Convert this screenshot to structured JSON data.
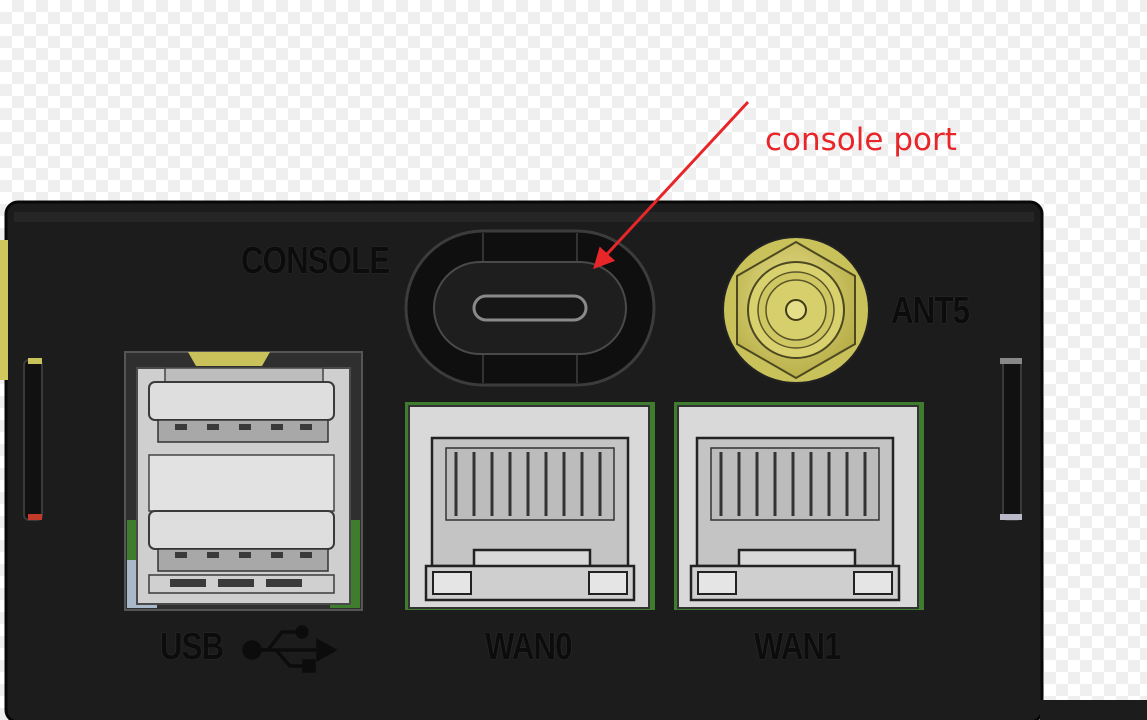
{
  "annotation": {
    "text": "console port",
    "color": "#e8262a"
  },
  "labels": {
    "console": "CONSOLE",
    "antenna": "ANT5",
    "usb": "USB",
    "wan0": "WAN0",
    "wan1": "WAN1"
  },
  "colors": {
    "enclosure": "#1c1c1c",
    "port_metal": "#d4d4d4",
    "antenna_connector": "#c9c15a",
    "pcb": "#3e7d2e"
  },
  "icons": {
    "usb_symbol": "usb-icon",
    "pointer": "arrow-icon"
  }
}
